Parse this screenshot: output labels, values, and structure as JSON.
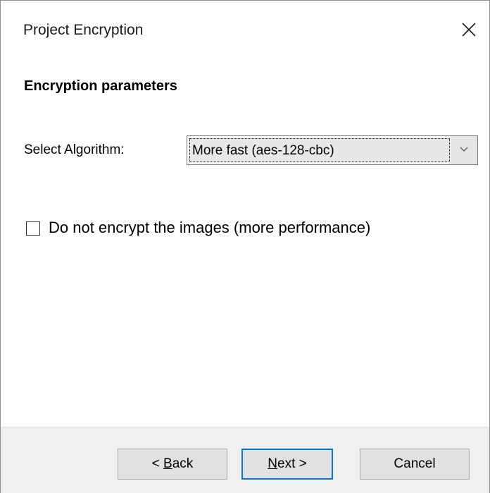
{
  "window": {
    "title": "Project Encryption"
  },
  "content": {
    "heading": "Encryption parameters",
    "algorithm_label": "Select Algorithm:",
    "algorithm_selected": "More fast (aes-128-cbc)",
    "checkbox_label": "Do not encrypt the images (more performance)",
    "checkbox_checked": false
  },
  "buttons": {
    "back_prefix": "< ",
    "back_accel": "B",
    "back_rest": "ack",
    "next_accel": "N",
    "next_rest": "ext >",
    "cancel": "Cancel"
  },
  "colors": {
    "focus_accent": "#0078d7",
    "footer_bg": "#f0f0f0",
    "button_bg": "#e1e1e1"
  },
  "icons": {
    "close": "close-icon",
    "dropdown": "chevron-down-icon"
  }
}
